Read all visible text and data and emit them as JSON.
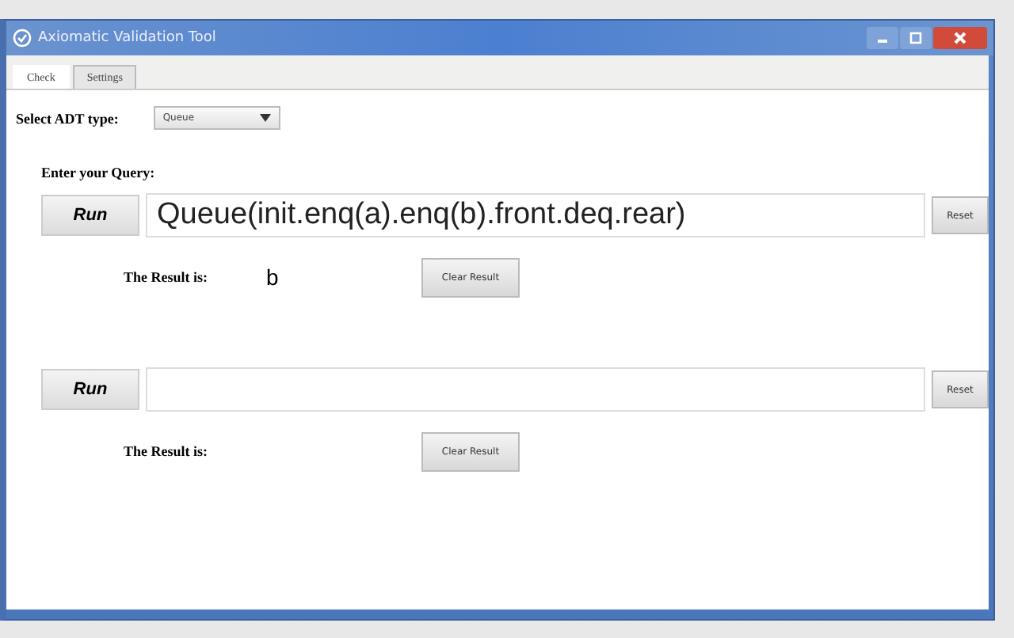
{
  "window": {
    "title": "Axiomatic Validation Tool"
  },
  "tabs": [
    {
      "label": "Check",
      "selected": true
    },
    {
      "label": "Settings",
      "selected": false
    }
  ],
  "adt_select": {
    "label": "Select ADT type:",
    "value": "Queue"
  },
  "query_prompt": "Enter your Query:",
  "queries": [
    {
      "run_label": "Run",
      "value": "Queue(init.enq(a).enq(b).front.deq.rear)",
      "reset_label": "Reset",
      "result_label": "The Result is:",
      "result": "b",
      "clear_label": "Clear Result"
    },
    {
      "run_label": "Run",
      "reset_label": "Reset",
      "result_label": "The Result is:",
      "clear_label": "Clear Result"
    }
  ]
}
